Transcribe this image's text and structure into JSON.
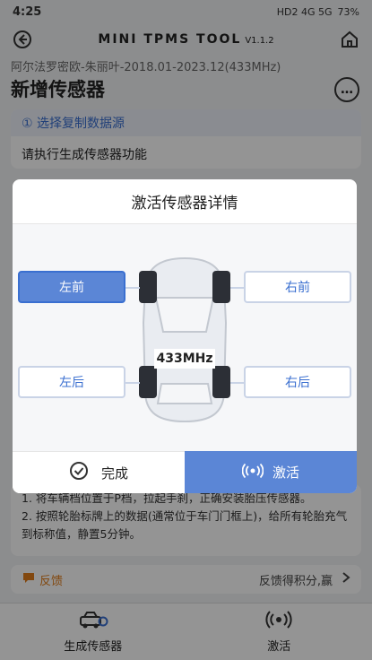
{
  "status": {
    "time": "4:25",
    "icons": "HD2 4G 5G",
    "battery": "73%"
  },
  "app": {
    "title": "MINI TPMS TOOL",
    "version": "V1.1.2"
  },
  "page": {
    "subtitle": "阿尔法罗密欧-朱丽叶-2018.01-2023.12(433MHz)",
    "title": "新增传感器",
    "more_label": "…"
  },
  "step": {
    "header": "① 选择复制数据源",
    "body": "请执行生成传感器功能"
  },
  "notes": {
    "line1": "1. 将车辆档位置于P档，拉起手刹，正确安装胎压传感器。",
    "line2": "2. 按照轮胎标牌上的数据(通常位于车门门框上)，给所有轮胎充气到标称值，静置5分钟。"
  },
  "feedback": {
    "label": "反馈",
    "tip": "反馈得积分,赢"
  },
  "nav": [
    {
      "label": "生成传感器",
      "icon": "car-sensor-icon"
    },
    {
      "label": "激活",
      "icon": "signal-icon"
    }
  ],
  "modal": {
    "title": "激活传感器详情",
    "frequency": "433MHz",
    "tires": {
      "front_left": "左前",
      "front_right": "右前",
      "rear_left": "左后",
      "rear_right": "右后"
    },
    "selected": "front_left",
    "done_label": "完成",
    "activate_label": "激活"
  },
  "colors": {
    "accent": "#5b86d6",
    "accent_dark": "#3a6fd0",
    "feedback": "#e07c1a"
  }
}
